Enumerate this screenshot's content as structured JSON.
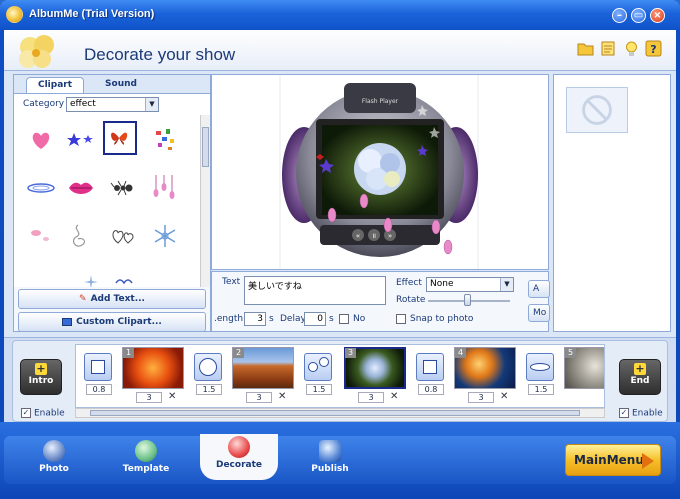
{
  "window": {
    "title": "AlbumMe (Trial Version)"
  },
  "header": {
    "title": "Decorate your show"
  },
  "clipart": {
    "tabs": [
      "Clipart",
      "Sound"
    ],
    "category_label": "Category",
    "category_value": "effect",
    "add_text_label": "Add Text...",
    "custom_clipart_label": "Custom Clipart..."
  },
  "props": {
    "text_label": "Text",
    "text_value": "美しいですね",
    "effect_label": "Effect",
    "effect_value": "None",
    "rotate_label": "Rotate",
    "snap_label": "Snap to photo",
    "length_label": ".ength",
    "length_value": "3",
    "length_unit": "s",
    "delay_label": "Delay",
    "delay_value": "0",
    "delay_unit": "s",
    "no_label": "No",
    "side_btn_1": "A",
    "side_btn_2": "Mo",
    "player_caption": "Flash Player"
  },
  "storyboard": {
    "intro_label": "Intro",
    "end_label": "End",
    "enable_label": "Enable",
    "transitions": [
      "0.8",
      "1.5",
      "1.5",
      "0.8",
      "1.5"
    ],
    "slides": [
      {
        "num": "1",
        "dur": "3"
      },
      {
        "num": "2",
        "dur": "3"
      },
      {
        "num": "3",
        "dur": "3"
      },
      {
        "num": "4",
        "dur": "3"
      },
      {
        "num": "5",
        "dur": ""
      }
    ]
  },
  "nav": {
    "items": [
      "Photo",
      "Template",
      "Decorate",
      "Publish"
    ],
    "active": "Decorate",
    "main_menu": "MainMenu"
  }
}
